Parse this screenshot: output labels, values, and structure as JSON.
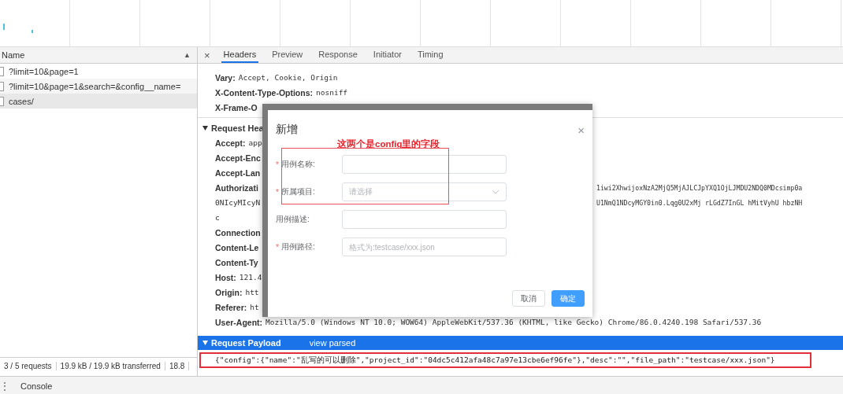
{
  "requests_panel": {
    "column_header": "Name",
    "sort_icon": "▲",
    "rows": [
      {
        "name": "?limit=10&page=1",
        "selected": false
      },
      {
        "name": "?limit=10&page=1&search=&config__name=",
        "selected": false
      },
      {
        "name": "cases/",
        "selected": true
      }
    ]
  },
  "status_bar": [
    "3 / 5 requests",
    "19.9 kB / 19.9 kB transferred",
    "18.8"
  ],
  "details": {
    "close": "×",
    "tabs": [
      {
        "label": "Headers",
        "selected": true
      },
      {
        "label": "Preview",
        "selected": false
      },
      {
        "label": "Response",
        "selected": false
      },
      {
        "label": "Initiator",
        "selected": false
      },
      {
        "label": "Timing",
        "selected": false
      }
    ],
    "response_headers": [
      {
        "name": "Vary:",
        "value": "Accept, Cookie, Origin"
      },
      {
        "name": "X-Content-Type-Options:",
        "value": "nosniff"
      },
      {
        "name": "X-Frame-O"
      }
    ],
    "request_headers": {
      "title": "Request Hea",
      "rows": [
        {
          "name": "Accept:",
          "value": "app"
        },
        {
          "name": "Accept-Enc"
        },
        {
          "name": "Accept-Lan"
        },
        {
          "name": "Authorizati",
          "value_right": "1iwi2XhwijoxNzA2MjQ5MjAJLCJpYXQ1OjLJMDU2NDQ0MDcsimp0a"
        },
        {
          "value": "0NIcyMIcyN",
          "value_right": "U1NmQ1NDcyMGY0in0.Lqg0U2xMj rLGdZ7InGL hMitVyhU hbzNH"
        },
        {
          "value": "c"
        },
        {
          "name": "Connection"
        },
        {
          "name": "Content-Le"
        },
        {
          "name": "Content-Ty"
        },
        {
          "name": "Host:",
          "value": "121.4"
        },
        {
          "name": "Origin:",
          "value": "htt"
        },
        {
          "name": "Referer:",
          "value": "ht"
        },
        {
          "name": "User-Agent:",
          "value": "Mozilla/5.0 (Windows NT 10.0; WOW64) AppleWebKit/537.36 (KHTML, like Gecko) Chrome/86.0.4240.198 Safari/537.36"
        }
      ]
    },
    "payload": {
      "title": "Request Payload",
      "toggle": "view parsed",
      "body": "{\"config\":{\"name\":\"乱写的可以删除\",\"project_id\":\"04dc5c412afa48c7a97e13cbe6ef96fe\"},\"desc\":\"\",\"file_path\":\"testcase/xxx.json\"}"
    }
  },
  "dialog": {
    "title": "新增",
    "close": "×",
    "annotation": "这两个是config里的字段",
    "fields": [
      {
        "marker": "*",
        "label": "用例名称:",
        "kind": "input"
      },
      {
        "marker": "*",
        "label": "所属项目:",
        "kind": "select",
        "placeholder": "请选择"
      },
      {
        "label": "用例描述:",
        "kind": "input"
      },
      {
        "marker": "*",
        "label": "用例路径:",
        "kind": "input",
        "placeholder": "格式为:testcase/xxx.json"
      }
    ],
    "buttons": [
      {
        "label": "取消",
        "kind": "default"
      },
      {
        "label": "确定",
        "kind": "primary"
      }
    ]
  },
  "drawer": {
    "menu": "⋮",
    "tab": "Console"
  }
}
